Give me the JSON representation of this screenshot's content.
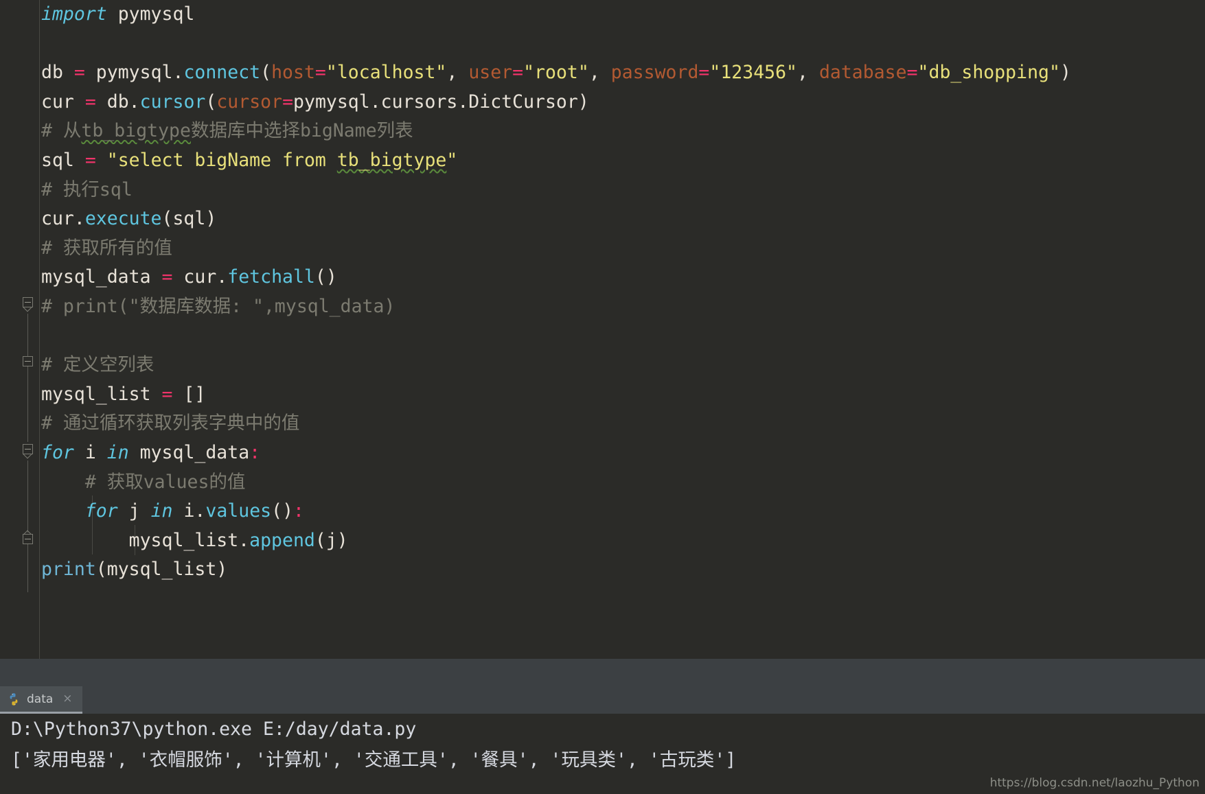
{
  "editor": {
    "background": "#2b2b28",
    "lines": [
      {
        "id": "l1",
        "text": "import pymysql",
        "segments": [
          {
            "cls": "kw",
            "text": "import"
          },
          {
            "cls": "plain",
            "text": " pymysql"
          }
        ]
      },
      {
        "id": "l2",
        "text": "",
        "segments": []
      },
      {
        "id": "l3",
        "text": "db = pymysql.connect(host=\"localhost\", user=\"root\", password=\"123456\", database=\"db_shopping\")",
        "segments": [
          {
            "cls": "plain",
            "text": "db "
          },
          {
            "cls": "op",
            "text": "="
          },
          {
            "cls": "plain",
            "text": " pymysql."
          },
          {
            "cls": "fn",
            "text": "connect"
          },
          {
            "cls": "plain",
            "text": "("
          },
          {
            "cls": "param",
            "text": "host"
          },
          {
            "cls": "op",
            "text": "="
          },
          {
            "cls": "str",
            "text": "\"localhost\""
          },
          {
            "cls": "plain",
            "text": ", "
          },
          {
            "cls": "param",
            "text": "user"
          },
          {
            "cls": "op",
            "text": "="
          },
          {
            "cls": "str",
            "text": "\"root\""
          },
          {
            "cls": "plain",
            "text": ", "
          },
          {
            "cls": "param",
            "text": "password"
          },
          {
            "cls": "op",
            "text": "="
          },
          {
            "cls": "str",
            "text": "\"123456\""
          },
          {
            "cls": "plain",
            "text": ", "
          },
          {
            "cls": "param",
            "text": "database"
          },
          {
            "cls": "op",
            "text": "="
          },
          {
            "cls": "str",
            "text": "\"db_shopping\""
          },
          {
            "cls": "plain",
            "text": ")"
          }
        ]
      },
      {
        "id": "l4",
        "text": "cur = db.cursor(cursor=pymysql.cursors.DictCursor)",
        "segments": [
          {
            "cls": "plain",
            "text": "cur "
          },
          {
            "cls": "op",
            "text": "="
          },
          {
            "cls": "plain",
            "text": " db."
          },
          {
            "cls": "fn",
            "text": "cursor"
          },
          {
            "cls": "plain",
            "text": "("
          },
          {
            "cls": "param",
            "text": "cursor"
          },
          {
            "cls": "op",
            "text": "="
          },
          {
            "cls": "plain",
            "text": "pymysql.cursors.DictCursor)"
          }
        ]
      },
      {
        "id": "l5",
        "text": "# 从tb_bigtype数据库中选择bigName列表",
        "segments": [
          {
            "cls": "comment",
            "text": "# 从"
          },
          {
            "cls": "comment wavy",
            "text": "tb_bigtype"
          },
          {
            "cls": "comment",
            "text": "数据库中选择bigName列表"
          }
        ]
      },
      {
        "id": "l6",
        "text": "sql = \"select bigName from tb_bigtype\"",
        "segments": [
          {
            "cls": "plain",
            "text": "sql "
          },
          {
            "cls": "op",
            "text": "="
          },
          {
            "cls": "plain",
            "text": " "
          },
          {
            "cls": "str",
            "text": "\"select bigName from "
          },
          {
            "cls": "str wavy",
            "text": "tb_bigtype"
          },
          {
            "cls": "str",
            "text": "\""
          }
        ]
      },
      {
        "id": "l7",
        "text": "# 执行sql",
        "segments": [
          {
            "cls": "comment",
            "text": "# 执行sql"
          }
        ]
      },
      {
        "id": "l8",
        "text": "cur.execute(sql)",
        "segments": [
          {
            "cls": "plain",
            "text": "cur."
          },
          {
            "cls": "fn",
            "text": "execute"
          },
          {
            "cls": "plain",
            "text": "(sql)"
          }
        ]
      },
      {
        "id": "l9",
        "text": "# 获取所有的值",
        "segments": [
          {
            "cls": "comment",
            "text": "# 获取所有的值"
          }
        ]
      },
      {
        "id": "l10",
        "text": "mysql_data = cur.fetchall()",
        "segments": [
          {
            "cls": "plain",
            "text": "mysql_data "
          },
          {
            "cls": "op",
            "text": "="
          },
          {
            "cls": "plain",
            "text": " cur."
          },
          {
            "cls": "fn",
            "text": "fetchall"
          },
          {
            "cls": "plain",
            "text": "()"
          }
        ]
      },
      {
        "id": "l11",
        "text": "# print(\"数据库数据: \",mysql_data)",
        "segments": [
          {
            "cls": "comment",
            "text": "# print(\"数据库数据: \",mysql_data)"
          }
        ]
      },
      {
        "id": "l12",
        "text": "",
        "segments": []
      },
      {
        "id": "l13",
        "text": "# 定义空列表",
        "segments": [
          {
            "cls": "comment",
            "text": "# 定义空列表"
          }
        ]
      },
      {
        "id": "l14",
        "text": "mysql_list = []",
        "segments": [
          {
            "cls": "plain",
            "text": "mysql_list "
          },
          {
            "cls": "op",
            "text": "="
          },
          {
            "cls": "plain",
            "text": " []"
          }
        ]
      },
      {
        "id": "l15",
        "text": "# 通过循环获取列表字典中的值",
        "segments": [
          {
            "cls": "comment",
            "text": "# 通过循环获取列表字典中的值"
          }
        ]
      },
      {
        "id": "l16",
        "text": "for i in mysql_data:",
        "segments": [
          {
            "cls": "kw",
            "text": "for"
          },
          {
            "cls": "plain",
            "text": " i "
          },
          {
            "cls": "kw",
            "text": "in"
          },
          {
            "cls": "plain",
            "text": " mysql_data"
          },
          {
            "cls": "colon",
            "text": ":"
          }
        ]
      },
      {
        "id": "l17",
        "text": "    # 获取values的值",
        "segments": [
          {
            "cls": "comment",
            "text": "    # 获取values的值"
          }
        ]
      },
      {
        "id": "l18",
        "text": "    for j in i.values():",
        "segments": [
          {
            "cls": "plain",
            "text": "    "
          },
          {
            "cls": "kw",
            "text": "for"
          },
          {
            "cls": "plain",
            "text": " j "
          },
          {
            "cls": "kw",
            "text": "in"
          },
          {
            "cls": "plain",
            "text": " i."
          },
          {
            "cls": "fn",
            "text": "values"
          },
          {
            "cls": "plain",
            "text": "()"
          },
          {
            "cls": "colon",
            "text": ":"
          }
        ]
      },
      {
        "id": "l19",
        "text": "        mysql_list.append(j)",
        "segments": [
          {
            "cls": "plain",
            "text": "        mysql_list."
          },
          {
            "cls": "fn",
            "text": "append"
          },
          {
            "cls": "plain",
            "text": "(j)"
          }
        ]
      },
      {
        "id": "l20",
        "text": "print(mysql_list)",
        "segments": [
          {
            "cls": "builtin",
            "text": "print"
          },
          {
            "cls": "plain",
            "text": "(mysql_list)"
          }
        ]
      }
    ]
  },
  "run_panel": {
    "tab": {
      "label": "data",
      "close_glyph": "×",
      "icon_name": "python-file-icon"
    },
    "console": {
      "command": "D:\\Python37\\python.exe E:/day/data.py",
      "output": "['家用电器', '衣帽服饰', '计算机', '交通工具', '餐具', '玩具类', '古玩类']"
    },
    "watermark": "https://blog.csdn.net/laozhu_Python"
  },
  "colors": {
    "editor_bg": "#2b2b28",
    "panel_bg": "#3c4043",
    "keyword": "#5fc6e0",
    "string": "#e8e07a",
    "comment": "#7c7b70",
    "operator": "#f0346a",
    "param": "#b35a32",
    "function": "#5fc6e0",
    "text": "#e8e2d8"
  }
}
